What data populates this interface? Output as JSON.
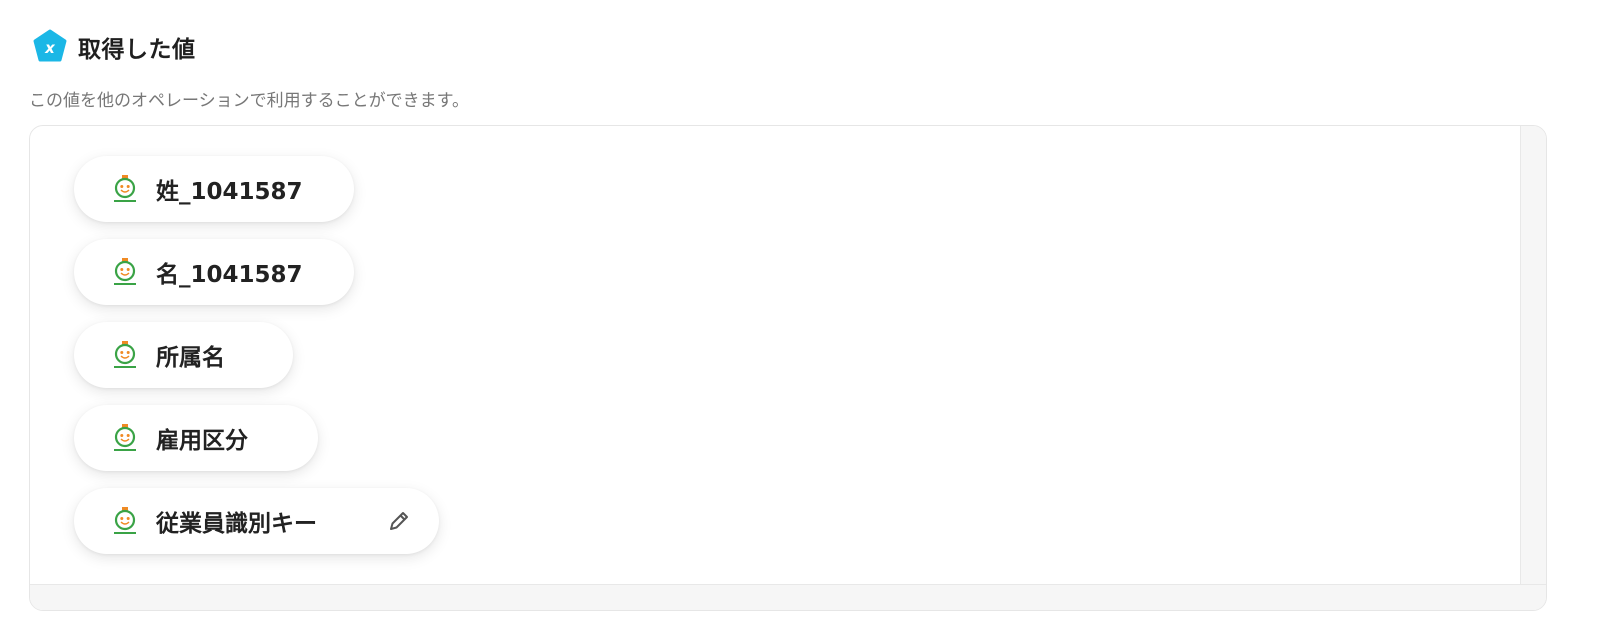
{
  "section": {
    "title": "取得した値",
    "description": "この値を他のオペレーションで利用することができます。",
    "badge_icon": "variable-x-icon",
    "accent_color": "#1bb7e6"
  },
  "values": [
    {
      "label": "姓_1041587",
      "icon": "app-logo-icon"
    },
    {
      "label": "名_1041587",
      "icon": "app-logo-icon"
    },
    {
      "label": "所属名",
      "icon": "app-logo-icon"
    },
    {
      "label": "雇用区分",
      "icon": "app-logo-icon"
    },
    {
      "label": "従業員識別キー",
      "icon": "app-logo-icon",
      "editable": true
    }
  ]
}
